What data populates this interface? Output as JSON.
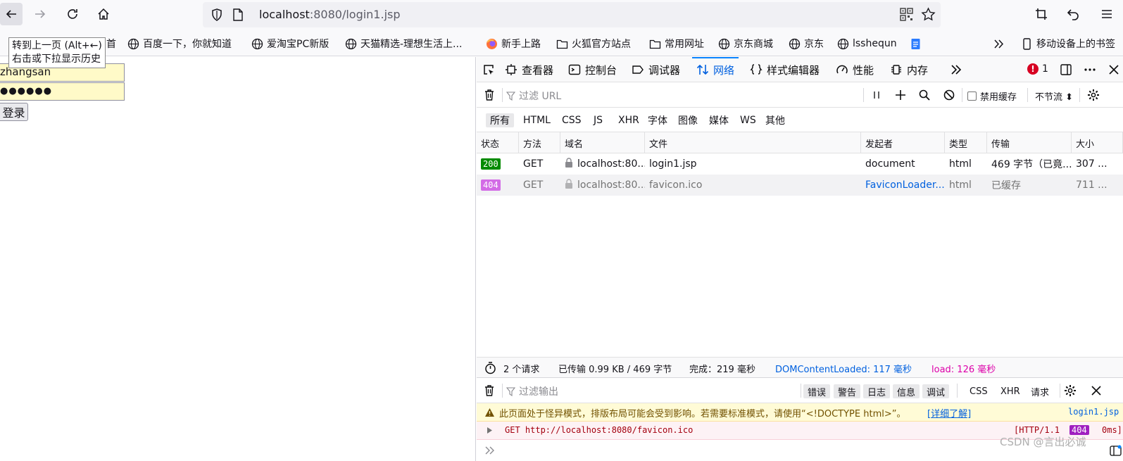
{
  "browser": {
    "url": {
      "host": "localhost",
      "rest": ":8080/login1.jsp"
    },
    "tooltip": {
      "line1": "转到上一页 (Alt+←)",
      "line2": "右击或下拉显示历史"
    }
  },
  "bookmarks": {
    "partial_first": "首",
    "items": [
      "百度一下，你就知道",
      "爱淘宝PC新版",
      "天猫精选-理想生活上...",
      "新手上路",
      "火狐官方站点",
      "常用网址",
      "京东商城",
      "京东",
      "lsshequn"
    ],
    "other": "移动设备上的书签"
  },
  "page": {
    "username_value": "zhangsan",
    "password_value": "●●●●●●",
    "login_label": "登录"
  },
  "devtools": {
    "tabs": [
      "查看器",
      "控制台",
      "调试器",
      "网络",
      "样式编辑器",
      "性能",
      "内存"
    ],
    "error_count": "1",
    "network": {
      "filter_placeholder": "过滤 URL",
      "disable_cache": "禁用缓存",
      "throttle": "不节流 ⬍",
      "type_filters": [
        "所有",
        "HTML",
        "CSS",
        "JS",
        "XHR",
        "字体",
        "图像",
        "媒体",
        "WS",
        "其他"
      ],
      "columns": [
        "状态",
        "方法",
        "域名",
        "文件",
        "发起者",
        "类型",
        "传输",
        "大小"
      ],
      "rows": [
        {
          "status": "200",
          "method": "GET",
          "domain": "localhost:80...",
          "file": "login1.jsp",
          "initiator": "document",
          "type": "html",
          "transfer": "469 字节（已竟...",
          "size": "307 ..."
        },
        {
          "status": "404",
          "method": "GET",
          "domain": "localhost:80...",
          "file": "favicon.ico",
          "initiator": "FaviconLoader....",
          "type": "html",
          "transfer": "已缓存",
          "size": "711 ..."
        }
      ],
      "summary": {
        "requests": "2 个请求",
        "transferred": "已传输 0.99 KB / 469 字节",
        "finish": "完成：219 毫秒",
        "dcl": "DOMContentLoaded: 117 毫秒",
        "load": "load: 126 毫秒"
      }
    },
    "console": {
      "filter_placeholder": "过滤输出",
      "levels": [
        "错误",
        "警告",
        "日志",
        "信息",
        "调试"
      ],
      "types": [
        "CSS",
        "XHR",
        "请求"
      ],
      "warning": {
        "text": "此页面处于怪异模式，排版布局可能会受到影响。若需要标准模式，请使用“<!DOCTYPE html>”。",
        "link": "[详细了解]",
        "source": "login1.jsp"
      },
      "error": {
        "text": "GET http://localhost:8080/favicon.ico",
        "proto": "[HTTP/1.1",
        "code": "404",
        "time": "0ms]"
      }
    }
  },
  "watermark": "CSDN @言出必诚"
}
